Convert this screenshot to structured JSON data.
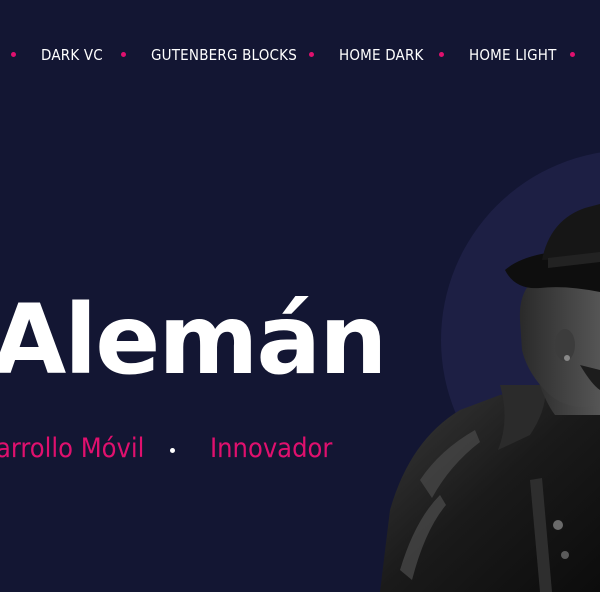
{
  "nav": {
    "items": [
      {
        "label": "DARK VC"
      },
      {
        "label": "GUTENBERG BLOCKS"
      },
      {
        "label": "HOME DARK"
      },
      {
        "label": "HOME LIGHT"
      }
    ]
  },
  "hero": {
    "name": "Alemán",
    "roles": [
      "arrollo Móvil",
      "Innovador"
    ]
  },
  "colors": {
    "background": "#131633",
    "circle": "#1d1f44",
    "accent": "#e0106e",
    "text": "#ffffff"
  }
}
